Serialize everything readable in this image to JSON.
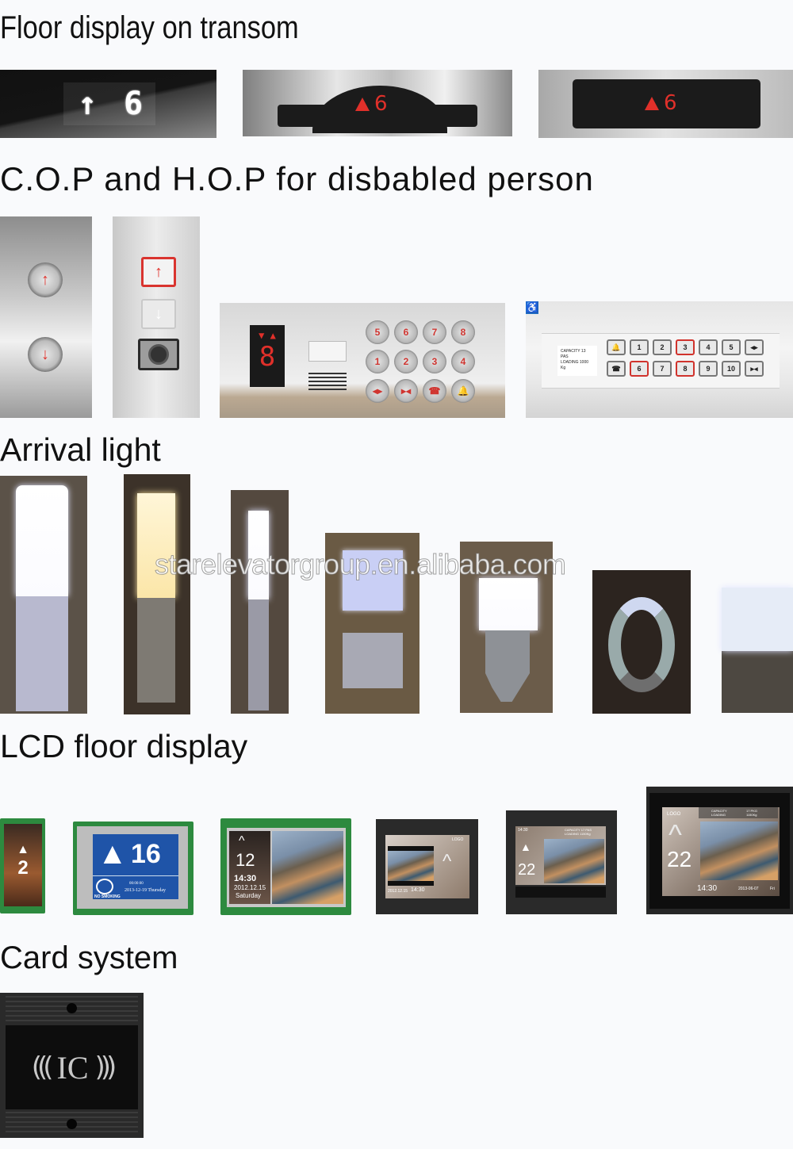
{
  "sections": {
    "floor_display": {
      "title": "Floor display on transom",
      "items": [
        {
          "type": "dot-matrix",
          "arrow": "↑",
          "floor": "6"
        },
        {
          "type": "dome-red-led",
          "arrow": "up",
          "floor": "6"
        },
        {
          "type": "rect-red-led",
          "arrow": "up",
          "floor": "6"
        }
      ]
    },
    "cop_hop": {
      "title": "C.O.P and H.O.P for disbabled person",
      "hop_round": {
        "up": "↑",
        "down": "↓"
      },
      "hop_square": {
        "up": "↑",
        "down": "↓",
        "key_switch": "key-switch"
      },
      "cop_horizontal": {
        "segment_floor": "8",
        "arrows": [
          "▼",
          "▲"
        ],
        "keys": [
          "5",
          "6",
          "7",
          "8",
          "1",
          "2",
          "3",
          "4",
          "◂▸",
          "▸◂",
          "☎",
          "🔔"
        ]
      },
      "cop_accessible": {
        "badge": "♿",
        "plate_lines": [
          "CAPACITY  13 PAS",
          "LOADING  1000 Kg"
        ],
        "keys": [
          "🔔",
          "1",
          "2",
          "3",
          "4",
          "5",
          "◂▸",
          "☎",
          "6",
          "7",
          "8",
          "9",
          "10",
          "▸◂"
        ],
        "lit_keys": [
          "3",
          "6",
          "8"
        ]
      }
    },
    "arrival_light": {
      "title": "Arrival light",
      "count": 7
    },
    "watermark": "starelevatorgroup.en.alibaba.com",
    "lcd": {
      "title": "LCD floor display",
      "screens": [
        {
          "floor": "2",
          "arrow": "▲"
        },
        {
          "floor": "16",
          "arrow": "▲",
          "no_smoking": "NO SMOKING",
          "date": "2013-12-19  Thursday",
          "time": "00:00:00"
        },
        {
          "floor": "12",
          "arrow": "^",
          "time": "14:30",
          "date": "2012.12.15",
          "day": "Saturday"
        },
        {
          "arrow": "^",
          "logo": "LOGO",
          "date": "2012.12.15",
          "time": "14:30"
        },
        {
          "floor": "22",
          "arrow": "▲",
          "time": "14:30",
          "capacity": "CAPACITY 17 PAS",
          "loading": "LOADING 1150Kg"
        },
        {
          "floor": "22",
          "arrow": "^",
          "logo": "LOGO",
          "capacity_label": "CAPACITY",
          "capacity_value": "17 PKG",
          "loading_label": "LOADING",
          "loading_value": "1150Kg",
          "time": "14:30",
          "date": "2013-06-07",
          "day": "Fri"
        }
      ]
    },
    "card": {
      "title": "Card system",
      "label": "IC",
      "waves_left": "(((",
      "waves_right": ")))"
    }
  }
}
